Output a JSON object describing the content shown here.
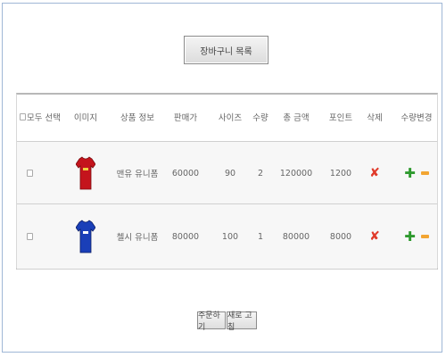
{
  "header": {
    "title": "장바구니 목록"
  },
  "table": {
    "columns": {
      "select_all": "모두 선택",
      "image": "이미지",
      "product_info": "상품 정보",
      "price": "판매가",
      "size": "사이즈",
      "quantity": "수량",
      "total": "총 금액",
      "point": "포인트",
      "delete": "삭제",
      "qty_change": "수량변경"
    },
    "rows": [
      {
        "name": "맨유 유니폼",
        "price": "60000",
        "size": "90",
        "qty": "2",
        "total": "120000",
        "point": "1200",
        "jersey_color": "#c4141c"
      },
      {
        "name": "첼시 유니폼",
        "price": "80000",
        "size": "100",
        "qty": "1",
        "total": "80000",
        "point": "8000",
        "jersey_color": "#1a3fb8"
      }
    ],
    "icons": {
      "delete": "✘",
      "plus": "✚"
    }
  },
  "actions": {
    "order_label": "주문하기",
    "refresh_label": "새로 고침"
  }
}
